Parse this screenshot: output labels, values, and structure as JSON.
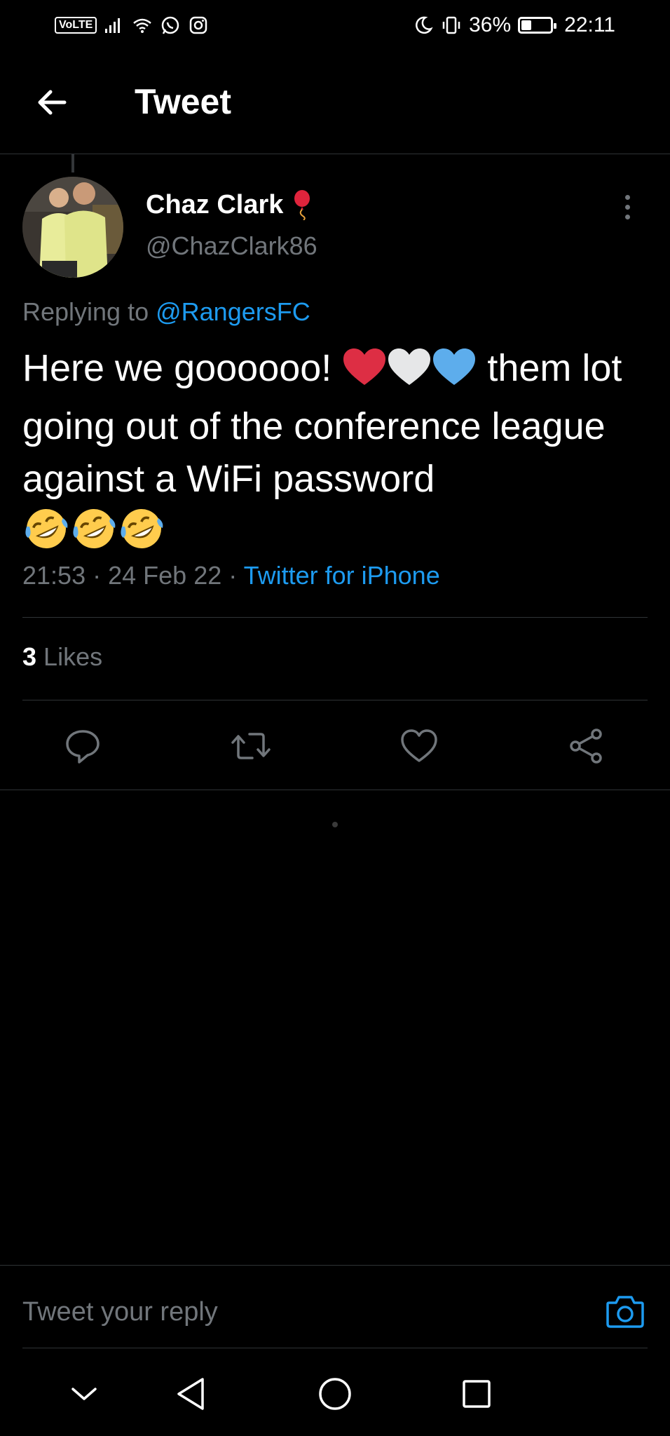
{
  "status_bar": {
    "network_badge": "VoLTE",
    "battery_text": "36%",
    "battery_level": 0.36,
    "time": "22:11"
  },
  "header": {
    "title": "Tweet",
    "back_icon": "arrow-left-icon"
  },
  "tweet": {
    "author_name": "Chaz Clark",
    "author_handle": "@ChazClark86",
    "name_emoji_icon": "balloon-icon",
    "replying_prefix": "Replying to ",
    "replying_to": "@RangersFC",
    "text_part1": "Here we goooooo!",
    "text_part2": "them lot going out of the conference league against a WiFi password",
    "hearts": [
      "red-heart-icon",
      "white-heart-icon",
      "blue-heart-icon"
    ],
    "laugh_emojis": [
      "rofl-emoji-icon",
      "rofl-emoji-icon",
      "rofl-emoji-icon"
    ],
    "time": "21:53",
    "date": "24 Feb 22",
    "source": "Twitter for iPhone",
    "likes_count": "3",
    "likes_label": "Likes"
  },
  "actions": {
    "reply_icon": "reply-icon",
    "retweet_icon": "retweet-icon",
    "like_icon": "heart-outline-icon",
    "share_icon": "share-icon"
  },
  "reply_bar": {
    "placeholder": "Tweet your reply",
    "camera_icon": "camera-icon"
  },
  "colors": {
    "background": "#000000",
    "link": "#1d9bf0",
    "secondary_text": "#71767b",
    "divider": "#2f3336"
  }
}
